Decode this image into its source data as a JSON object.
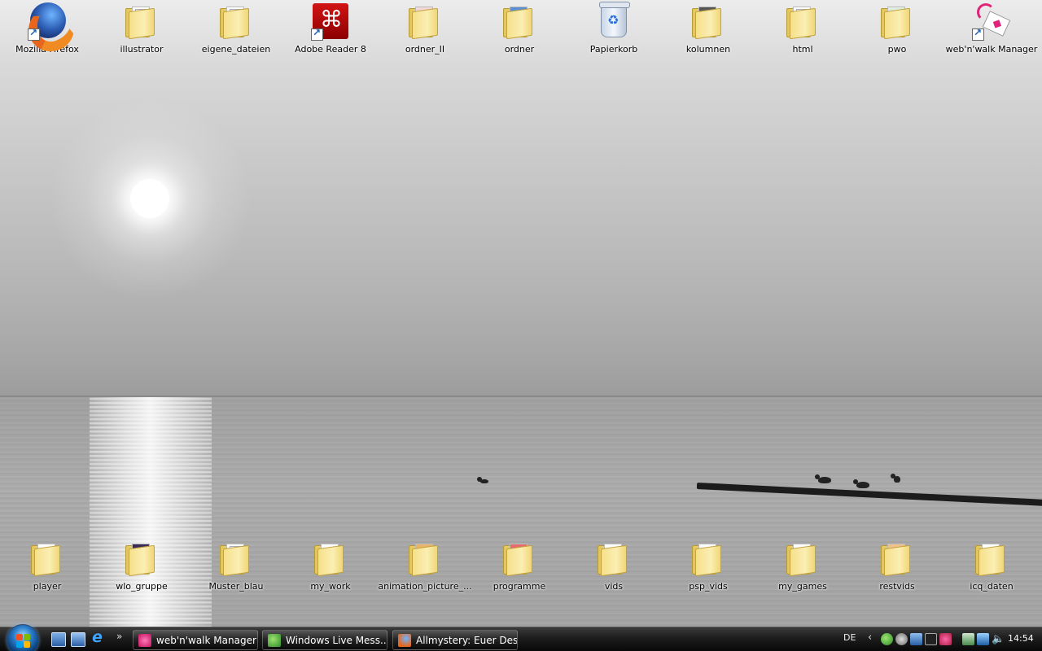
{
  "desktop": {
    "top_row": [
      {
        "label": "Mozilla Firefox",
        "icon": "firefox-icon"
      },
      {
        "label": "illustrator",
        "icon": "folder-icon"
      },
      {
        "label": "eigene_dateien",
        "icon": "folder-icon"
      },
      {
        "label": "Adobe Reader 8",
        "icon": "adobe-reader-icon"
      },
      {
        "label": "ordner_II",
        "icon": "folder-icon"
      },
      {
        "label": "ordner",
        "icon": "folder-icon"
      },
      {
        "label": "Papierkorb",
        "icon": "recycle-bin-icon"
      },
      {
        "label": "kolumnen",
        "icon": "folder-icon"
      },
      {
        "label": "html",
        "icon": "folder-icon"
      },
      {
        "label": "pwo",
        "icon": "folder-icon"
      },
      {
        "label": "web'n'walk Manager",
        "icon": "webnwalk-icon"
      }
    ],
    "bottom_row": [
      {
        "label": "player",
        "icon": "folder-icon"
      },
      {
        "label": "wlo_gruppe",
        "icon": "folder-icon"
      },
      {
        "label": "Muster_blau",
        "icon": "folder-icon"
      },
      {
        "label": "my_work",
        "icon": "folder-icon"
      },
      {
        "label": "animation_picture_...",
        "icon": "folder-icon"
      },
      {
        "label": "programme",
        "icon": "folder-icon"
      },
      {
        "label": "vids",
        "icon": "folder-icon"
      },
      {
        "label": "psp_vids",
        "icon": "folder-icon"
      },
      {
        "label": "my_games",
        "icon": "folder-icon"
      },
      {
        "label": "restvids",
        "icon": "folder-icon"
      },
      {
        "label": "icq_daten",
        "icon": "folder-icon"
      }
    ]
  },
  "taskbar": {
    "quick_launch": [
      "show-desktop-icon",
      "switch-windows-icon",
      "internet-explorer-icon"
    ],
    "more_label": "»",
    "buttons": [
      {
        "label": "web'n'walk Manager",
        "icon": "webnwalk-icon"
      },
      {
        "label": "Windows Live Mess...",
        "icon": "messenger-icon"
      },
      {
        "label": "Allmystery: Euer Des...",
        "icon": "firefox-icon"
      }
    ],
    "tray": {
      "language": "DE",
      "chevron": "‹",
      "time": "14:54"
    }
  }
}
